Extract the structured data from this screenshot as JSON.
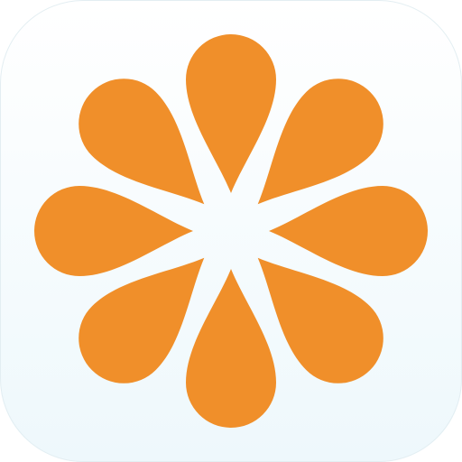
{
  "icon": {
    "name": "orange-flower-app-icon",
    "petal_count": 8,
    "colors": {
      "petal": "#F08F2A",
      "background_top": "#FFFFFF",
      "background_bottom": "#EEF8FC",
      "edge_shadow": "#E3EEF2"
    }
  }
}
